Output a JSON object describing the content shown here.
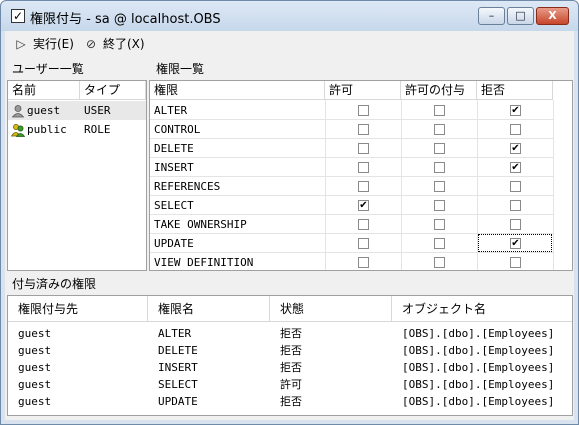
{
  "window": {
    "title": "権限付与 - sa @ localhost.OBS",
    "minimize": "–",
    "maximize": "□",
    "close": "X"
  },
  "toolbar": {
    "run_label": "実行(E)",
    "exit_label": "終了(X)"
  },
  "users_section": {
    "title": "ユーザー一覧",
    "columns": [
      "名前",
      "タイプ"
    ],
    "rows": [
      {
        "name": "guest",
        "type": "USER",
        "icon": "user-icon"
      },
      {
        "name": "public",
        "type": "ROLE",
        "icon": "group-icon"
      }
    ]
  },
  "permissions_section": {
    "title": "権限一覧",
    "columns": [
      "権限",
      "許可",
      "許可の付与",
      "拒否"
    ],
    "rows": [
      {
        "name": "ALTER",
        "grant": false,
        "with_grant": false,
        "deny": true
      },
      {
        "name": "CONTROL",
        "grant": false,
        "with_grant": false,
        "deny": false
      },
      {
        "name": "DELETE",
        "grant": false,
        "with_grant": false,
        "deny": true
      },
      {
        "name": "INSERT",
        "grant": false,
        "with_grant": false,
        "deny": true
      },
      {
        "name": "REFERENCES",
        "grant": false,
        "with_grant": false,
        "deny": false
      },
      {
        "name": "SELECT",
        "grant": true,
        "with_grant": false,
        "deny": false
      },
      {
        "name": "TAKE OWNERSHIP",
        "grant": false,
        "with_grant": false,
        "deny": false
      },
      {
        "name": "UPDATE",
        "grant": false,
        "with_grant": false,
        "deny": true
      },
      {
        "name": "VIEW DEFINITION",
        "grant": false,
        "with_grant": false,
        "deny": false
      }
    ]
  },
  "granted_section": {
    "title": "付与済みの権限",
    "columns": [
      "権限付与先",
      "権限名",
      "状態",
      "オブジェクト名"
    ],
    "rows": [
      [
        "guest",
        "ALTER",
        "拒否",
        "[OBS].[dbo].[Employees]"
      ],
      [
        "guest",
        "DELETE",
        "拒否",
        "[OBS].[dbo].[Employees]"
      ],
      [
        "guest",
        "INSERT",
        "拒否",
        "[OBS].[dbo].[Employees]"
      ],
      [
        "guest",
        "SELECT",
        "許可",
        "[OBS].[dbo].[Employees]"
      ],
      [
        "guest",
        "UPDATE",
        "拒否",
        "[OBS].[dbo].[Employees]"
      ]
    ]
  },
  "colors": {
    "titlebar": "#c7d8ec",
    "selected_row": "#e8e8e8"
  }
}
